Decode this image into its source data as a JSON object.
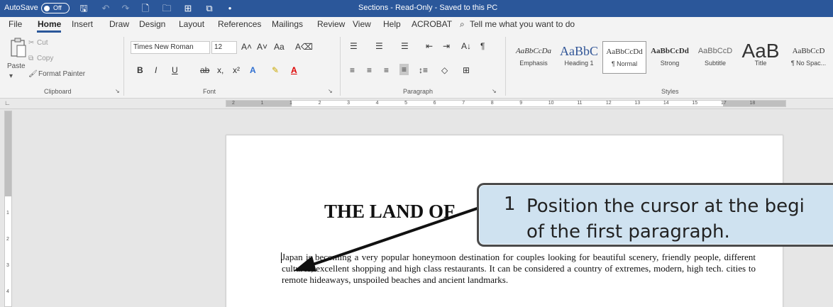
{
  "titlebar": {
    "autosave_label": "AutoSave",
    "autosave_state": "Off",
    "document_title": "Sections - Read-Only - Saved to this PC",
    "icons": [
      "save-icon",
      "undo-icon",
      "redo-icon",
      "new-document-icon",
      "open-folder-icon",
      "table-icon",
      "screenshot-icon",
      "more-icon"
    ]
  },
  "menu": {
    "items": [
      "File",
      "Home",
      "Insert",
      "Draw",
      "Design",
      "Layout",
      "References",
      "Mailings",
      "Review",
      "View",
      "Help",
      "ACROBAT"
    ],
    "active": "Home",
    "tell_me": "Tell me what you want to do"
  },
  "ribbon": {
    "clipboard": {
      "paste": "Paste",
      "cut": "Cut",
      "copy": "Copy",
      "format_painter": "Format Painter",
      "label": "Clipboard"
    },
    "font": {
      "name": "Times New Roman",
      "size": "12",
      "grow": "A˄",
      "shrink": "A˅",
      "case": "Aa",
      "clear": "A⌫",
      "bold": "B",
      "italic": "I",
      "underline": "U",
      "strike": "ab",
      "subscript": "x,",
      "superscript": "x²",
      "effects": "A",
      "highlight": "✎",
      "color": "A",
      "label": "Font"
    },
    "paragraph": {
      "bullets": "☰",
      "numbering": "☰",
      "multilevel": "☰",
      "decrease": "⇤",
      "increase": "⇥",
      "sort": "A↓",
      "pilcrow": "¶",
      "align_left": "≡",
      "center": "≡",
      "align_right": "≡",
      "justify": "≡",
      "spacing": "↕≡",
      "shading": "◇",
      "borders": "⊞",
      "label": "Paragraph"
    },
    "styles": {
      "items": [
        {
          "sample": "AaBbCcDa",
          "name": "Emphasis"
        },
        {
          "sample": "AaBbC",
          "name": "Heading 1"
        },
        {
          "sample": "AaBbCcDd",
          "name": "¶ Normal"
        },
        {
          "sample": "AaBbCcDd",
          "name": "Strong"
        },
        {
          "sample": "AaBbCcD",
          "name": "Subtitle"
        },
        {
          "sample": "AaB",
          "name": "Title"
        },
        {
          "sample": "AaBbCcD",
          "name": "¶ No Spac..."
        }
      ],
      "selected": "¶ Normal",
      "label": "Styles"
    }
  },
  "ruler": {
    "ticks": [
      "2",
      "1",
      "1",
      "2",
      "3",
      "4",
      "5",
      "6",
      "7",
      "8",
      "9",
      "10",
      "11",
      "12",
      "13",
      "14",
      "15",
      "17",
      "18"
    ],
    "vticks": [
      "1",
      "2",
      "3",
      "4"
    ]
  },
  "document": {
    "heading": "THE LAND OF",
    "paragraph": "Japan is becoming a very popular honeymoon destination for couples looking for beautiful scenery, friendly people, different cultures, excellent shopping and high class restaurants. It can be considered a country of extremes, modern, high tech. cities to remote hideaways, unspoiled beaches and ancient landmarks."
  },
  "callout": {
    "step": "1",
    "text": "Position the cursor at the begi\nof the first paragraph."
  },
  "colors": {
    "titlebar": "#2b579a",
    "ribbon": "#f3f3f3",
    "callout": "#cfe2f0",
    "canvas": "#e6e6e6"
  }
}
